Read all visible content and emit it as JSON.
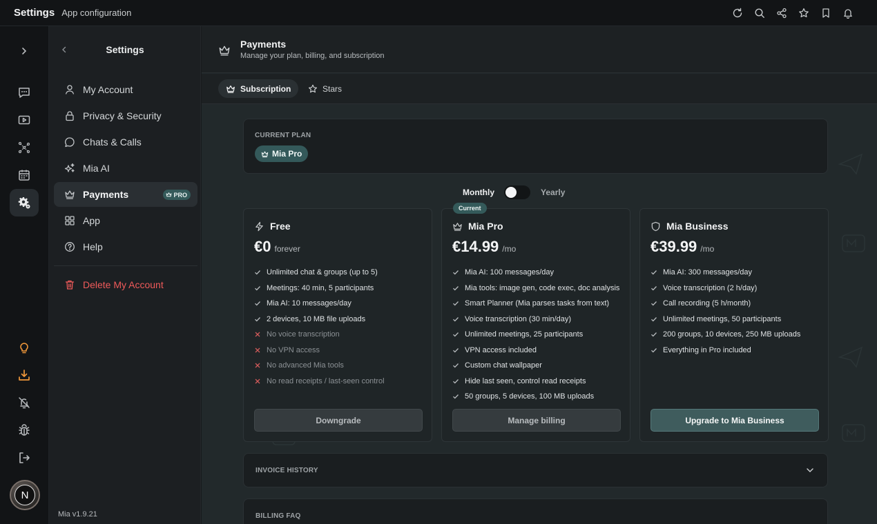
{
  "window": {
    "title": "Settings",
    "subtitle": "App configuration"
  },
  "topbar_icons": [
    "refresh-icon",
    "search-icon",
    "share-icon",
    "star-icon",
    "bookmark-icon",
    "bell-icon"
  ],
  "rail": {
    "icons": [
      "chevron-right-icon",
      "chat-icon",
      "video-icon",
      "network-icon",
      "calendar-icon",
      "settings-icon",
      "lightbulb-icon",
      "download-icon",
      "bell-off-icon",
      "bug-icon",
      "logout-icon"
    ],
    "avatar_letter": "N"
  },
  "sidebar": {
    "title": "Settings",
    "items": [
      {
        "label": "My Account",
        "icon": "user-icon"
      },
      {
        "label": "Privacy & Security",
        "icon": "lock-icon"
      },
      {
        "label": "Chats & Calls",
        "icon": "chat-bubble-icon"
      },
      {
        "label": "Mia AI",
        "icon": "sparkles-icon"
      },
      {
        "label": "Payments",
        "icon": "crown-icon",
        "badge": "PRO"
      },
      {
        "label": "App",
        "icon": "grid-icon"
      },
      {
        "label": "Help",
        "icon": "help-icon"
      }
    ],
    "delete_label": "Delete My Account",
    "version": "Mia v1.9.21"
  },
  "page": {
    "title": "Payments",
    "subtitle": "Manage your plan, billing, and subscription",
    "tabs": [
      {
        "label": "Subscription",
        "icon": "crown-icon",
        "active": true
      },
      {
        "label": "Stars",
        "icon": "star-icon",
        "active": false
      }
    ]
  },
  "current_plan": {
    "label": "CURRENT PLAN",
    "value": "Mia Pro"
  },
  "billing_toggle": {
    "monthly": "Monthly",
    "yearly": "Yearly",
    "selected": "Monthly"
  },
  "plans": [
    {
      "name": "Free",
      "icon": "bolt-icon",
      "price": "€0",
      "period": "forever",
      "features": [
        {
          "text": "Unlimited chat & groups (up to 5)",
          "included": true
        },
        {
          "text": "Meetings: 40 min, 5 participants",
          "included": true
        },
        {
          "text": "Mia AI: 10 messages/day",
          "included": true
        },
        {
          "text": "2 devices, 10 MB file uploads",
          "included": true
        },
        {
          "text": "No voice transcription",
          "included": false
        },
        {
          "text": "No VPN access",
          "included": false
        },
        {
          "text": "No advanced Mia tools",
          "included": false
        },
        {
          "text": "No read receipts / last-seen control",
          "included": false
        }
      ],
      "button": "Downgrade"
    },
    {
      "name": "Mia Pro",
      "icon": "crown-icon",
      "price": "€14.99",
      "period": "/mo",
      "badge": "Current",
      "features": [
        {
          "text": "Mia AI: 100 messages/day",
          "included": true
        },
        {
          "text": "Mia tools: image gen, code exec, doc analysis",
          "included": true
        },
        {
          "text": "Smart Planner (Mia parses tasks from text)",
          "included": true
        },
        {
          "text": "Voice transcription (30 min/day)",
          "included": true
        },
        {
          "text": "Unlimited meetings, 25 participants",
          "included": true
        },
        {
          "text": "VPN access included",
          "included": true
        },
        {
          "text": "Custom chat wallpaper",
          "included": true
        },
        {
          "text": "Hide last seen, control read receipts",
          "included": true
        },
        {
          "text": "50 groups, 5 devices, 100 MB uploads",
          "included": true
        }
      ],
      "button": "Manage billing"
    },
    {
      "name": "Mia Business",
      "icon": "shield-icon",
      "price": "€39.99",
      "period": "/mo",
      "features": [
        {
          "text": "Mia AI: 300 messages/day",
          "included": true
        },
        {
          "text": "Voice transcription (2 h/day)",
          "included": true
        },
        {
          "text": "Call recording (5 h/month)",
          "included": true
        },
        {
          "text": "Unlimited meetings, 50 participants",
          "included": true
        },
        {
          "text": "200 groups, 10 devices, 250 MB uploads",
          "included": true
        },
        {
          "text": "Everything in Pro included",
          "included": true
        }
      ],
      "button": "Upgrade to Mia Business"
    }
  ],
  "sections": {
    "invoice_history": "INVOICE HISTORY",
    "billing_faq": "BILLING FAQ"
  }
}
